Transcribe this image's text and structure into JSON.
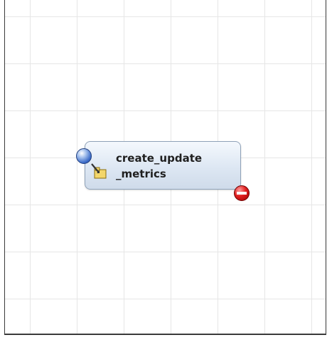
{
  "canvas": {
    "node": {
      "label": "create_update\n_metrics",
      "icon": "arrow-into-folder-icon",
      "input_port_icon": "blue-ball-port-icon",
      "output_port_icon": "red-stop-port-icon"
    },
    "colors": {
      "grid": "#e6e6e6",
      "node_fill": "#dde7f3",
      "node_border": "#8fa2b8",
      "input_port": "#3b6bc8",
      "output_port": "#e02020"
    }
  }
}
